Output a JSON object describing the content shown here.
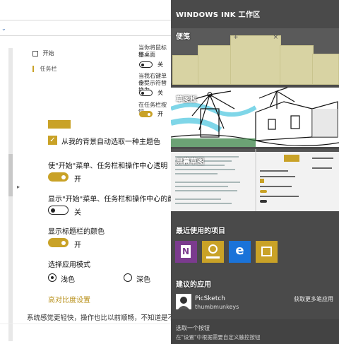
{
  "settings": {
    "nav": {
      "start": "开始",
      "taskbar": "任务栏"
    },
    "small_texts": {
      "line1": "当你将鼠标移",
      "line2": "览桌面",
      "line3": "当我右键单击\"",
      "line4": "令提示符替换为",
      "line5": "在任务栏按钮"
    },
    "toggles_small": {
      "off1": "关",
      "off2": "关",
      "on1": "开"
    },
    "auto_color_label": "从我的背景自动选取一种主题色",
    "start_transparent_label": "使\"开始\"菜单、任务栏和操作中心透明",
    "start_transparent_state": "开",
    "show_color_label": "显示\"开始\"菜单、任务栏和操作中心的颜",
    "show_color_state": "关",
    "titlebar_color_label": "显示标题栏的颜色",
    "titlebar_color_state": "开",
    "app_mode_label": "选择应用模式",
    "mode_light": "浅色",
    "mode_dark": "深色",
    "high_contrast_link": "高对比度设置",
    "bottom_text": "系统感觉更轻快，操作也比以前顺畅，不知道是不"
  },
  "ink": {
    "title": "WINDOWS INK 工作区",
    "sticky_label": "便笺",
    "sketchpad_label": "草图板",
    "screensketch_label": "屏幕草图",
    "recent_label": "最近使用的项目",
    "recent_apps": [
      {
        "name": "onenote-icon",
        "color": "#7b3b8e",
        "glyph": "N"
      },
      {
        "name": "maps-pin-icon",
        "color": "#c9a227",
        "glyph": "⊚"
      },
      {
        "name": "edge-icon",
        "color": "#1a73d9",
        "glyph": "e"
      },
      {
        "name": "photos-icon",
        "color": "#c9a227",
        "glyph": "▲"
      }
    ],
    "suggested_label": "建议的应用",
    "suggested_app": {
      "name": "PicSketch",
      "developer": "thumbmunkeys"
    },
    "more_link": "获取更多笔应用",
    "footer_line1": "选取一个按钮",
    "footer_line2": "在\"设置\"中根据需要自定义触控按钮"
  },
  "colors": {
    "accent": "#c9a227",
    "panel_bg": "#4a4a4a"
  }
}
